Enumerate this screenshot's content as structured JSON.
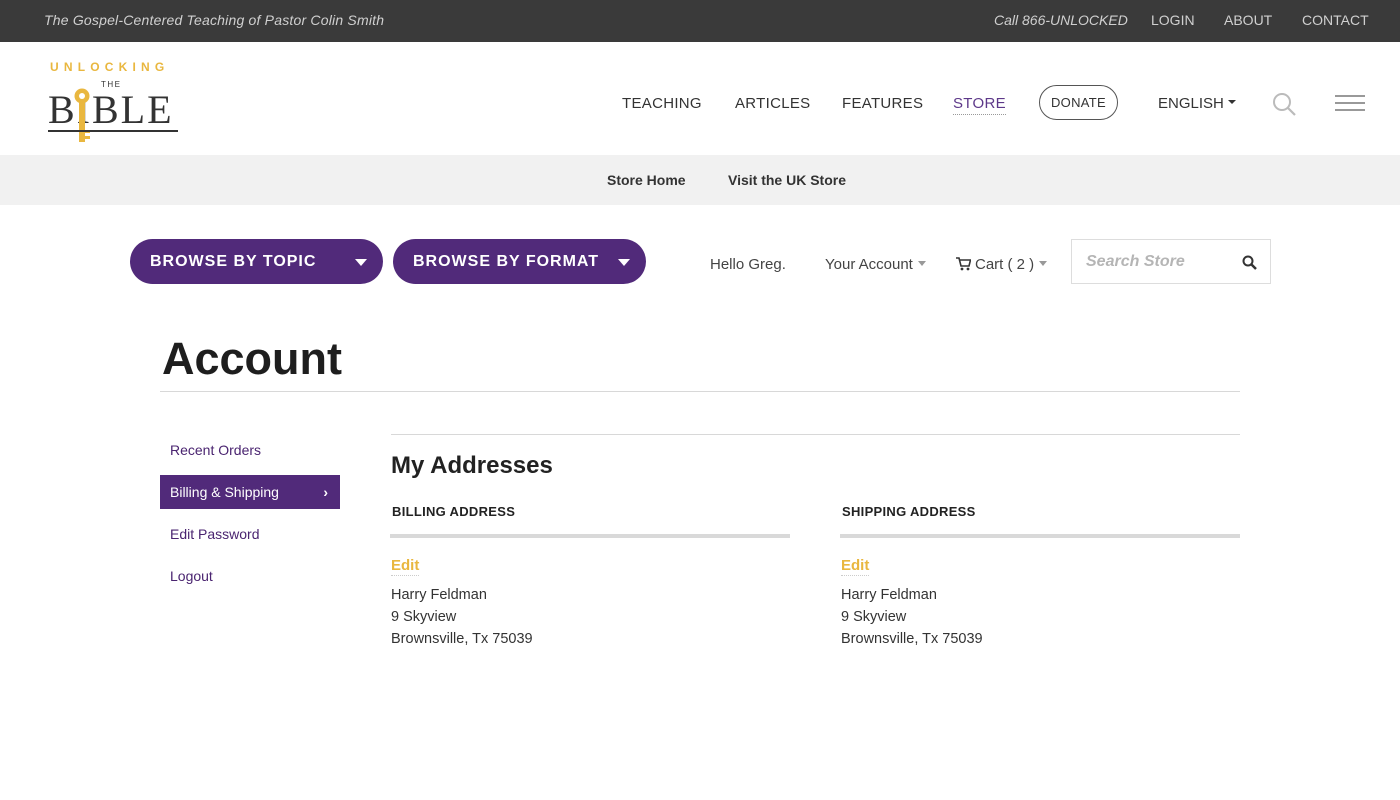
{
  "topbar": {
    "tagline": "The Gospel-Centered Teaching of Pastor Colin Smith",
    "phone": "Call 866-UNLOCKED",
    "links": {
      "login": "LOGIN",
      "about": "ABOUT",
      "contact": "CONTACT"
    }
  },
  "logo": {
    "line1": "UNLOCKING",
    "line2": "THE",
    "line3": "BIBLE"
  },
  "nav": {
    "teaching": "TEACHING",
    "articles": "ARTICLES",
    "features": "FEATURES",
    "store": "STORE",
    "donate": "DONATE",
    "language": "ENGLISH"
  },
  "substrip": {
    "store_home": "Store Home",
    "uk_store": "Visit the UK Store"
  },
  "store_bar": {
    "browse_topic": "BROWSE BY TOPIC",
    "browse_format": "BROWSE BY FORMAT",
    "greeting": "Hello Greg.",
    "account": "Your Account",
    "cart": "Cart ( 2 )",
    "search_placeholder": "Search Store"
  },
  "page": {
    "title": "Account"
  },
  "sidebar": {
    "items": [
      {
        "label": "Recent Orders",
        "selected": false
      },
      {
        "label": "Billing & Shipping",
        "selected": true
      },
      {
        "label": "Edit Password",
        "selected": false
      },
      {
        "label": "Logout",
        "selected": false
      }
    ]
  },
  "addresses": {
    "title": "My Addresses",
    "billing": {
      "heading": "BILLING ADDRESS",
      "edit": "Edit",
      "name": "Harry Feldman",
      "street": "9 Skyview",
      "city": "Brownsville, Tx 75039"
    },
    "shipping": {
      "heading": "SHIPPING ADDRESS",
      "edit": "Edit",
      "name": "Harry Feldman",
      "street": "9 Skyview",
      "city": "Brownsville, Tx 75039"
    }
  },
  "colors": {
    "brand_purple": "#512a7a",
    "accent_gold": "#e9b73f",
    "topbar_bg": "#3a3a3a"
  },
  "icons": [
    "key-icon",
    "search-icon",
    "menu-icon",
    "cart-icon",
    "chevron-right-icon",
    "caret-down-icon"
  ]
}
